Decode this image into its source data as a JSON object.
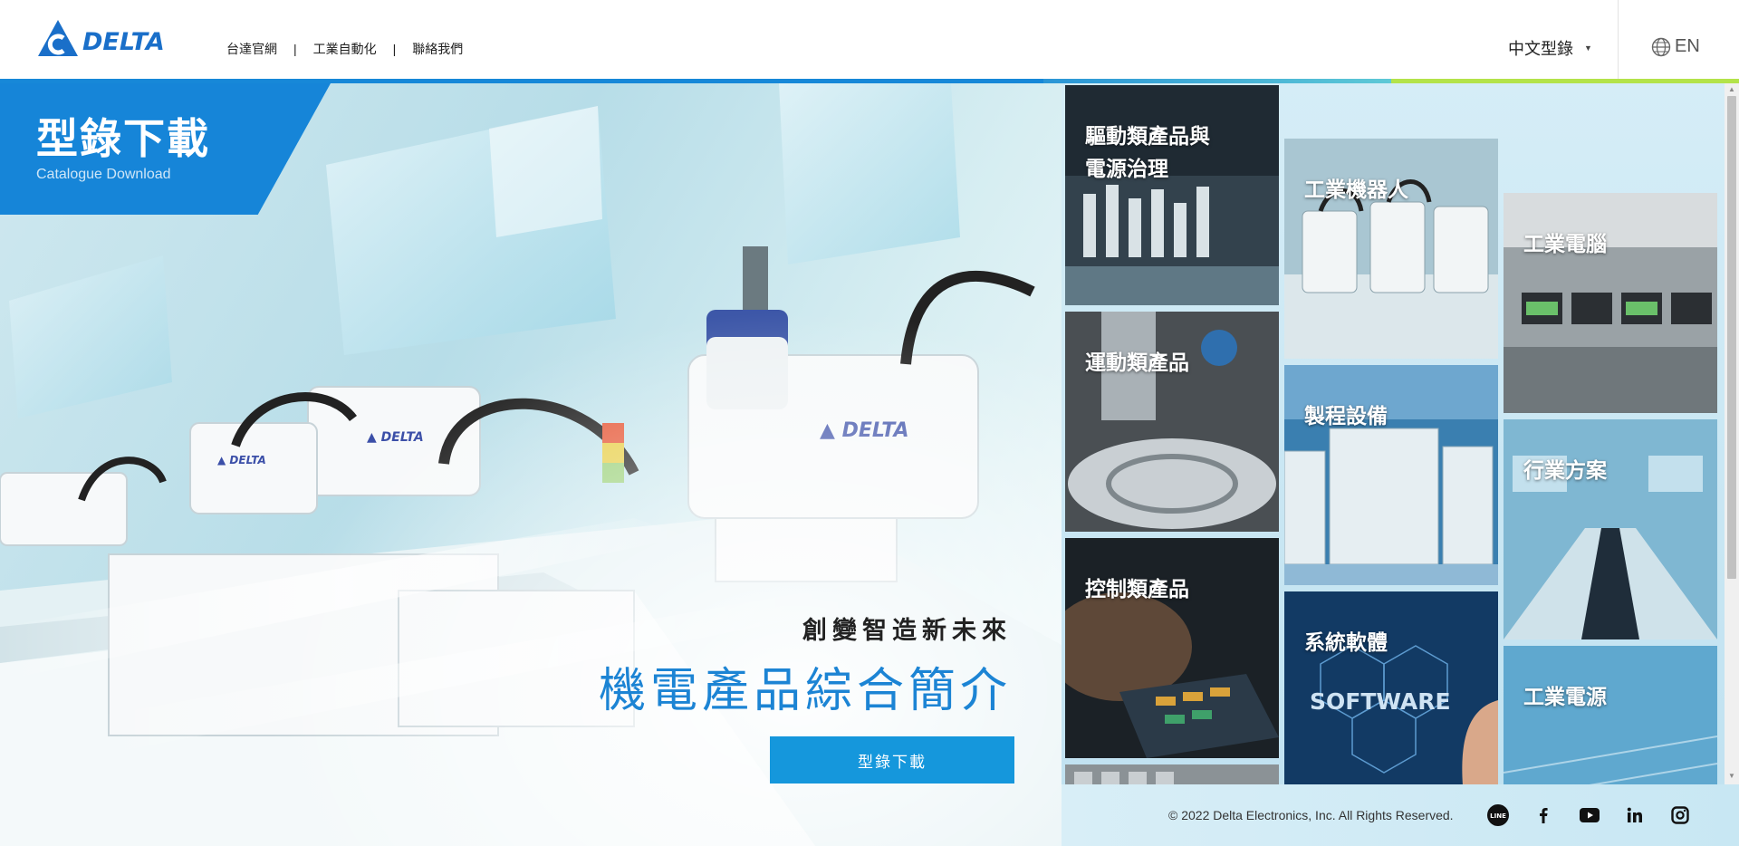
{
  "header": {
    "logo_text": "DELTA",
    "nav": [
      {
        "label": "台達官網"
      },
      {
        "label": "工業自動化"
      },
      {
        "label": "聯絡我們"
      }
    ],
    "separator": "|",
    "catalog_select": "中文型錄",
    "language": "EN"
  },
  "hero": {
    "title_zh": "型錄下載",
    "title_en": "Catalogue Download",
    "slogan": "創變智造新未來",
    "headline": "機電產品綜合簡介",
    "button_label": "型錄下載"
  },
  "categories": [
    {
      "label": "驅動類產品與\n電源治理"
    },
    {
      "label": "運動類產品"
    },
    {
      "label": "控制類產品"
    },
    {
      "label": "工業機器人"
    },
    {
      "label": "製程設備"
    },
    {
      "label": "系統軟體"
    },
    {
      "label": "工業電腦"
    },
    {
      "label": "行業方案"
    },
    {
      "label": "工業電源"
    }
  ],
  "footer": {
    "copyright": "© 2022 Delta Electronics, Inc. All Rights Reserved.",
    "social_icons": [
      "line-icon",
      "facebook-icon",
      "youtube-icon",
      "linkedin-icon",
      "instagram-icon"
    ]
  },
  "colors": {
    "brand_blue": "#1685d8",
    "accent_cyan": "#5ec9d6",
    "accent_green": "#b3e34a",
    "button_blue": "#1597dc"
  }
}
